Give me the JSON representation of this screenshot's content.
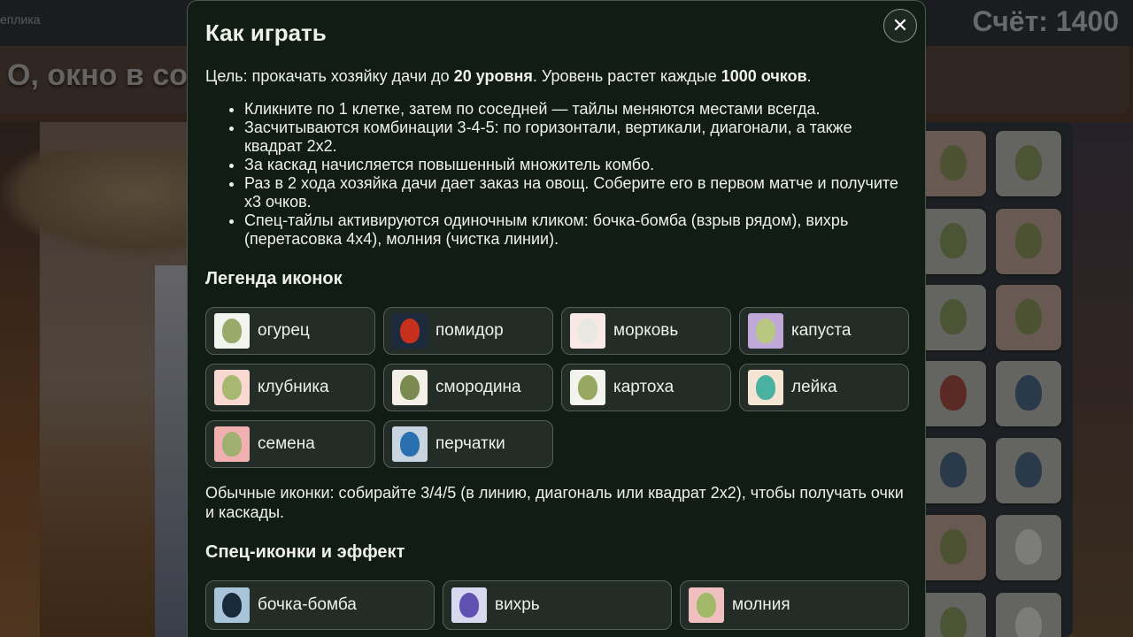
{
  "game": {
    "brand": "еплика",
    "score_label": "Счёт: 1400",
    "banner": "О, окно в со"
  },
  "modal": {
    "title": "Как играть",
    "close_label": "✕",
    "goal_prefix": "Цель: прокачать хозяйку дачи до ",
    "goal_level": "20 уровня",
    "goal_middle": ". Уровень растет каждые ",
    "goal_points": "1000 очков",
    "goal_suffix": ".",
    "rules": [
      "Кликните по 1 клетке, затем по соседней — тайлы меняются местами всегда.",
      "Засчитываются комбинации 3-4-5: по горизонтали, вертикали, диагонали, а также квадрат 2х2.",
      "За каскад начисляется повышенный множитель комбо.",
      "Раз в 2 хода хозяйка дачи дает заказ на овощ. Соберите его в первом матче и получите х3 очков.",
      "Спец-тайлы активируются одиночным кликом: бочка-бомба (взрыв рядом), вихрь (перетасовка 4х4), молния (чистка линии)."
    ],
    "legend_title": "Легенда иконок",
    "legend": [
      {
        "label": "огурец",
        "icon": "cucumber-icon",
        "bg": "#f2f4ee",
        "fg": "#9aaa6a"
      },
      {
        "label": "помидор",
        "icon": "tomato-icon",
        "bg": "#1c2a3c",
        "fg": "#c8301e"
      },
      {
        "label": "морковь",
        "icon": "carrot-icon",
        "bg": "#f8e8e6",
        "fg": "#e8e8e0"
      },
      {
        "label": "капуста",
        "icon": "cabbage-icon",
        "bg": "#c0a8d8",
        "fg": "#b8c880"
      },
      {
        "label": "клубника",
        "icon": "strawberry-icon",
        "bg": "#f8d8d0",
        "fg": "#a8b870"
      },
      {
        "label": "смородина",
        "icon": "currant-icon",
        "bg": "#f4f0e8",
        "fg": "#7a8a50"
      },
      {
        "label": "картоха",
        "icon": "potato-icon",
        "bg": "#f4f4ee",
        "fg": "#98a860"
      },
      {
        "label": "лейка",
        "icon": "watering-can-icon",
        "bg": "#f4e4d4",
        "fg": "#4ab0a0"
      },
      {
        "label": "семена",
        "icon": "seeds-icon",
        "bg": "#f0b0b0",
        "fg": "#a0b070"
      },
      {
        "label": "перчатки",
        "icon": "gloves-icon",
        "bg": "#c8d4e0",
        "fg": "#2a70b0"
      }
    ],
    "note": "Обычные иконки: собирайте 3/4/5 (в линию, диагональ или квадрат 2х2), чтобы получать очки и каскады.",
    "special_title": "Спец-иконки и эффект",
    "special": [
      {
        "label": "бочка-бомба",
        "icon": "barrel-bomb-icon",
        "bg": "#a8c4d8",
        "fg": "#1a2a3a"
      },
      {
        "label": "вихрь",
        "icon": "whirl-icon",
        "bg": "#d8d8f0",
        "fg": "#6050b0"
      },
      {
        "label": "молния",
        "icon": "lightning-icon",
        "bg": "#f0c0c0",
        "fg": "#a0b868"
      }
    ]
  }
}
